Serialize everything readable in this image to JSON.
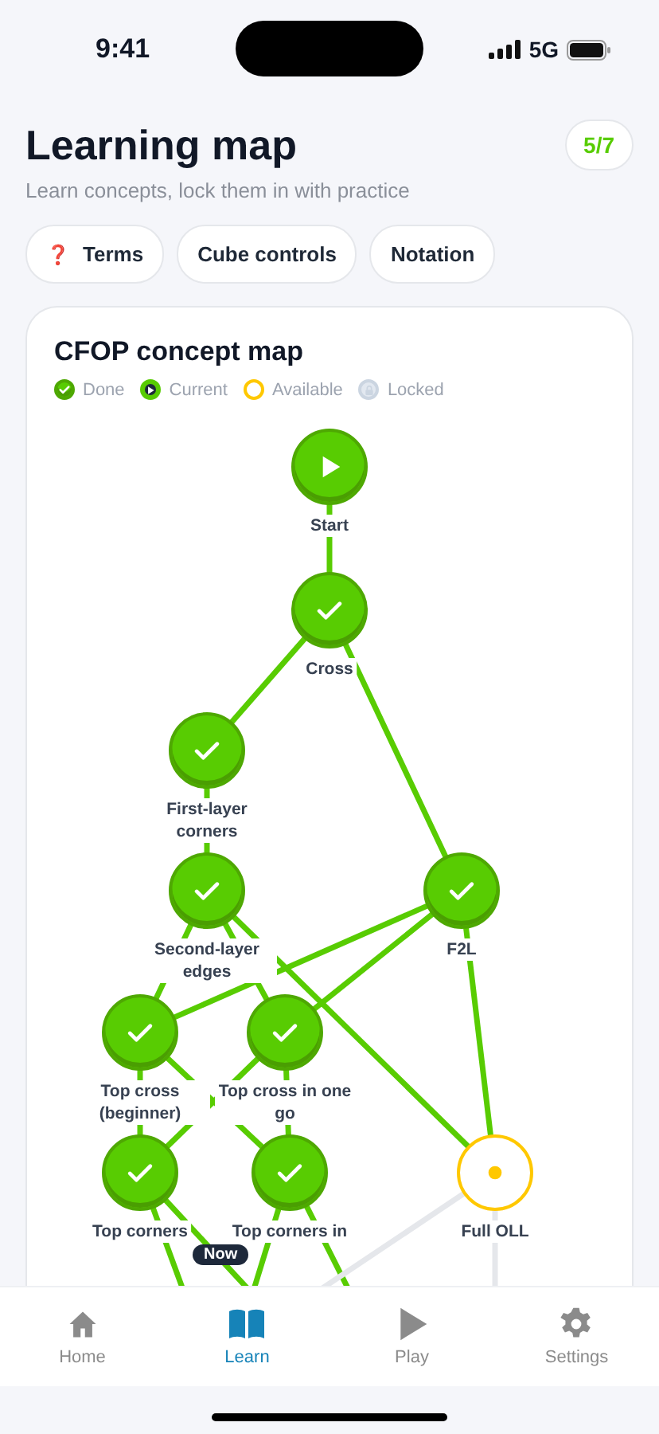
{
  "status_bar": {
    "time": "9:41",
    "network": "5G"
  },
  "header": {
    "title": "Learning map",
    "subtitle": "Learn concepts, lock them in with practice",
    "progress": "5/7"
  },
  "chips": [
    {
      "icon": "❓",
      "label": "Terms"
    },
    {
      "label": "Cube controls"
    },
    {
      "label": "Notation"
    }
  ],
  "map": {
    "title": "CFOP concept map",
    "legend": [
      {
        "label": "Done",
        "kind": "done"
      },
      {
        "label": "Current",
        "kind": "current"
      },
      {
        "label": "Available",
        "kind": "available"
      },
      {
        "label": "Locked",
        "kind": "locked"
      }
    ],
    "nodes": [
      {
        "label": "Start",
        "kind": "start"
      },
      {
        "label": "Cross",
        "kind": "done"
      },
      {
        "label": "First-layer corners",
        "kind": "done"
      },
      {
        "label": "Second-layer edges",
        "kind": "done"
      },
      {
        "label": "F2L",
        "kind": "done"
      },
      {
        "label": "Top cross (beginner)",
        "kind": "done"
      },
      {
        "label": "Top cross in one go",
        "kind": "done"
      },
      {
        "label": "Top corners",
        "kind": "done"
      },
      {
        "label": "Top corners in",
        "kind": "done"
      },
      {
        "label": "Full OLL",
        "kind": "available"
      }
    ],
    "badge": "Now"
  },
  "tab_bar": [
    {
      "label": "Home",
      "selected": false
    },
    {
      "label": "Learn",
      "selected": true
    },
    {
      "label": "Play",
      "selected": false
    },
    {
      "label": "Settings",
      "selected": false
    }
  ]
}
